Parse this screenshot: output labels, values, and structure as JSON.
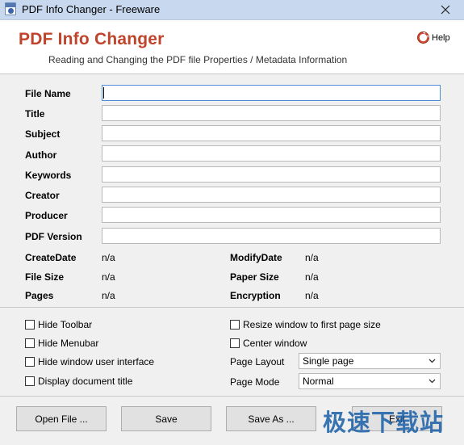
{
  "window": {
    "title": "PDF Info Changer - Freeware"
  },
  "header": {
    "app_name": "PDF Info Changer",
    "subtitle": "Reading and Changing the PDF file Properties / Metadata Information",
    "help_label": "Help"
  },
  "fields": [
    {
      "label": "File Name",
      "value": ""
    },
    {
      "label": "Title",
      "value": ""
    },
    {
      "label": "Subject",
      "value": ""
    },
    {
      "label": "Author",
      "value": ""
    },
    {
      "label": "Keywords",
      "value": ""
    },
    {
      "label": "Creator",
      "value": ""
    },
    {
      "label": "Producer",
      "value": ""
    },
    {
      "label": "PDF Version",
      "value": ""
    }
  ],
  "info": {
    "create_date": {
      "label": "CreateDate",
      "value": "n/a"
    },
    "modify_date": {
      "label": "ModifyDate",
      "value": "n/a"
    },
    "file_size": {
      "label": "File Size",
      "value": "n/a"
    },
    "paper_size": {
      "label": "Paper Size",
      "value": "n/a"
    },
    "pages": {
      "label": "Pages",
      "value": "n/a"
    },
    "encryption": {
      "label": "Encryption",
      "value": "n/a"
    }
  },
  "options": {
    "hide_toolbar": "Hide Toolbar",
    "hide_menubar": "Hide Menubar",
    "hide_window_ui": "Hide window user interface",
    "display_doc_title": "Display document title",
    "resize_window": "Resize window to first page size",
    "center_window": "Center window",
    "page_layout": {
      "label": "Page Layout",
      "value": "Single page"
    },
    "page_mode": {
      "label": "Page Mode",
      "value": "Normal"
    }
  },
  "buttons": {
    "open_file": "Open File ...",
    "save": "Save",
    "save_as": "Save As ...",
    "exit": "Exit"
  },
  "watermark": "极速下载站",
  "colors": {
    "title_accent": "#c0442c",
    "titlebar": "#c8d8ef",
    "focus_border": "#4f8ed7",
    "watermark": "#1a5fa8"
  },
  "icons": {
    "app": "pdf-info-app-icon",
    "help": "lifebuoy-icon",
    "close": "close-icon",
    "dropdown": "chevron-down-icon"
  }
}
